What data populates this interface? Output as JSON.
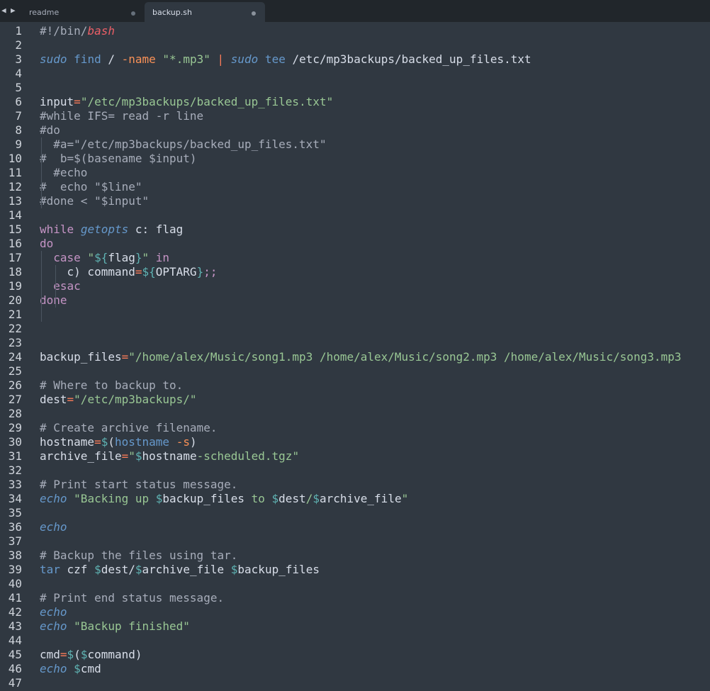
{
  "tabs": [
    {
      "label": "readme",
      "active": false
    },
    {
      "label": "backup.sh",
      "active": true
    }
  ],
  "nav": {
    "left_icon": "triangle-left-icon",
    "right_icon": "triangle-right-icon"
  },
  "colors": {
    "background": "#303841",
    "tab_bar": "#21262b",
    "comment": "#a7adba",
    "string": "#99c794",
    "variable": "#5fb3b3",
    "keyword": "#c594c5",
    "function": "#6699cc",
    "operator": "#f97b58"
  },
  "editor": {
    "line_numbers": [
      "1",
      "2",
      "3",
      "4",
      "5",
      "6",
      "7",
      "8",
      "9",
      "10",
      "11",
      "12",
      "13",
      "14",
      "15",
      "16",
      "17",
      "18",
      "19",
      "20",
      "21",
      "22",
      "23",
      "24",
      "25",
      "26",
      "27",
      "28",
      "29",
      "30",
      "31",
      "32",
      "33",
      "34",
      "35",
      "36",
      "37",
      "38",
      "39",
      "40",
      "41",
      "42",
      "43",
      "44",
      "45",
      "46",
      "47"
    ],
    "lines": [
      [
        [
          "#!/bin/",
          "cmt"
        ],
        [
          "bash",
          "red"
        ]
      ],
      [],
      [
        [
          "sudo",
          "fnit"
        ],
        [
          " ",
          "plain"
        ],
        [
          "find",
          "fn"
        ],
        [
          " / ",
          "plain"
        ],
        [
          "-name",
          "opt"
        ],
        [
          " ",
          "plain"
        ],
        [
          "\"*.mp3\"",
          "str"
        ],
        [
          " ",
          "plain"
        ],
        [
          "|",
          "op"
        ],
        [
          " ",
          "plain"
        ],
        [
          "sudo",
          "fnit"
        ],
        [
          " ",
          "plain"
        ],
        [
          "tee",
          "fn"
        ],
        [
          " /etc/mp3backups/backed_up_files.txt",
          "plain"
        ]
      ],
      [],
      [],
      [
        [
          "input",
          "plain"
        ],
        [
          "=",
          "op"
        ],
        [
          "\"/etc/mp3backups/backed_up_files.txt\"",
          "str"
        ]
      ],
      [
        [
          "#while IFS= read -r line",
          "cmt"
        ]
      ],
      [
        [
          "#do",
          "cmt"
        ]
      ],
      [
        [
          "  #a=\"/etc/mp3backups/backed_up_files.txt\"",
          "cmt"
        ]
      ],
      [
        [
          "#  b=$(basename $input)",
          "cmt"
        ]
      ],
      [
        [
          "  #echo",
          "cmt"
        ]
      ],
      [
        [
          "#  echo \"$line\"",
          "cmt"
        ]
      ],
      [
        [
          "#done < \"$input\"",
          "cmt"
        ]
      ],
      [],
      [
        [
          "while",
          "kw"
        ],
        [
          " ",
          "plain"
        ],
        [
          "getopts",
          "fnit"
        ],
        [
          " c: flag",
          "plain"
        ]
      ],
      [
        [
          "do",
          "kw"
        ]
      ],
      [
        [
          "  ",
          "plain"
        ],
        [
          "case",
          "kw"
        ],
        [
          " ",
          "plain"
        ],
        [
          "\"",
          "str"
        ],
        [
          "${",
          "var"
        ],
        [
          "flag",
          "plain"
        ],
        [
          "}",
          "var"
        ],
        [
          "\"",
          "str"
        ],
        [
          " ",
          "plain"
        ],
        [
          "in",
          "kw"
        ]
      ],
      [
        [
          "    c) command",
          "plain"
        ],
        [
          "=",
          "op"
        ],
        [
          "${",
          "var"
        ],
        [
          "OPTARG",
          "plain"
        ],
        [
          "}",
          "var"
        ],
        [
          ";;",
          "kw"
        ]
      ],
      [
        [
          "  ",
          "plain"
        ],
        [
          "esac",
          "kw"
        ]
      ],
      [
        [
          "done",
          "kw"
        ]
      ],
      [],
      [],
      [],
      [
        [
          "backup_files",
          "plain"
        ],
        [
          "=",
          "op"
        ],
        [
          "\"/home/alex/Music/song1.mp3 /home/alex/Music/song2.mp3 /home/alex/Music/song3.mp3",
          "str"
        ]
      ],
      [],
      [
        [
          "# Where to backup to.",
          "cmt"
        ]
      ],
      [
        [
          "dest",
          "plain"
        ],
        [
          "=",
          "op"
        ],
        [
          "\"/etc/mp3backups/\"",
          "str"
        ]
      ],
      [],
      [
        [
          "# Create archive filename.",
          "cmt"
        ]
      ],
      [
        [
          "hostname",
          "plain"
        ],
        [
          "=",
          "op"
        ],
        [
          "$",
          "var"
        ],
        [
          "(",
          "plain"
        ],
        [
          "hostname",
          "fn"
        ],
        [
          " ",
          "plain"
        ],
        [
          "-s",
          "opt"
        ],
        [
          ")",
          "plain"
        ]
      ],
      [
        [
          "archive_file",
          "plain"
        ],
        [
          "=",
          "op"
        ],
        [
          "\"",
          "str"
        ],
        [
          "$",
          "var"
        ],
        [
          "hostname",
          "plain"
        ],
        [
          "-scheduled.tgz\"",
          "str"
        ]
      ],
      [],
      [
        [
          "# Print start status message.",
          "cmt"
        ]
      ],
      [
        [
          "echo",
          "fnit"
        ],
        [
          " ",
          "plain"
        ],
        [
          "\"Backing up ",
          "str"
        ],
        [
          "$",
          "var"
        ],
        [
          "backup_files",
          "plain"
        ],
        [
          " to ",
          "str"
        ],
        [
          "$",
          "var"
        ],
        [
          "dest",
          "plain"
        ],
        [
          "/",
          "str"
        ],
        [
          "$",
          "var"
        ],
        [
          "archive_file",
          "plain"
        ],
        [
          "\"",
          "str"
        ]
      ],
      [],
      [
        [
          "echo",
          "fnit"
        ]
      ],
      [],
      [
        [
          "# Backup the files using tar.",
          "cmt"
        ]
      ],
      [
        [
          "tar",
          "fn"
        ],
        [
          " czf ",
          "plain"
        ],
        [
          "$",
          "var"
        ],
        [
          "dest/",
          "plain"
        ],
        [
          "$",
          "var"
        ],
        [
          "archive_file ",
          "plain"
        ],
        [
          "$",
          "var"
        ],
        [
          "backup_files",
          "plain"
        ]
      ],
      [],
      [
        [
          "# Print end status message.",
          "cmt"
        ]
      ],
      [
        [
          "echo",
          "fnit"
        ]
      ],
      [
        [
          "echo",
          "fnit"
        ],
        [
          " ",
          "plain"
        ],
        [
          "\"Backup finished\"",
          "str"
        ]
      ],
      [],
      [
        [
          "cmd",
          "plain"
        ],
        [
          "=",
          "op"
        ],
        [
          "$",
          "var"
        ],
        [
          "(",
          "plain"
        ],
        [
          "$",
          "var"
        ],
        [
          "command",
          "plain"
        ],
        [
          ")",
          "plain"
        ]
      ],
      [
        [
          "echo",
          "fnit"
        ],
        [
          " ",
          "plain"
        ],
        [
          "$",
          "var"
        ],
        [
          "cmd",
          "plain"
        ]
      ],
      []
    ]
  }
}
